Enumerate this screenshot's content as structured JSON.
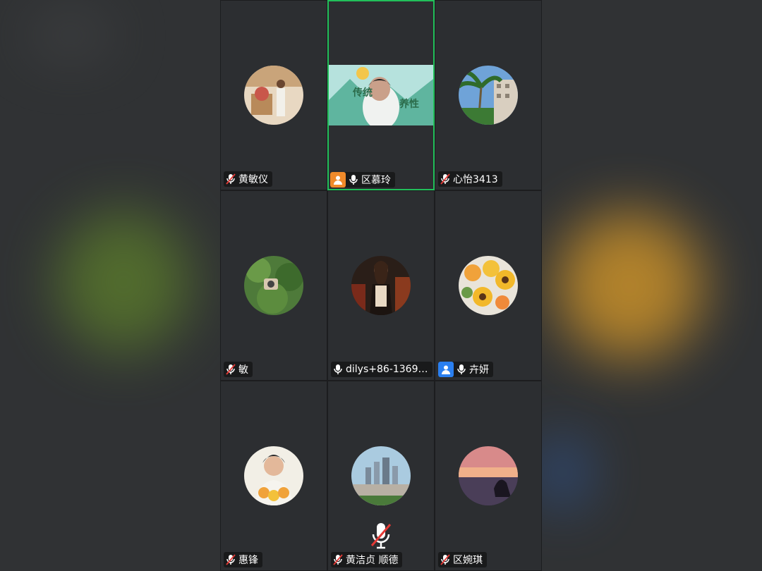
{
  "participants": [
    {
      "name": "黄敏仪",
      "mic": "muted",
      "role": null,
      "video": false,
      "active": false
    },
    {
      "name": "区慕玲",
      "mic": "on",
      "role": "host",
      "video": true,
      "active": true
    },
    {
      "name": "心怡3413",
      "mic": "muted",
      "role": null,
      "video": false,
      "active": false
    },
    {
      "name": "敏",
      "mic": "muted",
      "role": null,
      "video": false,
      "active": false
    },
    {
      "name": "dilys+86-13690…",
      "mic": "on",
      "role": null,
      "video": false,
      "active": false
    },
    {
      "name": "卉妍",
      "mic": "on",
      "role": "cohost",
      "video": false,
      "active": false
    },
    {
      "name": "惠锋",
      "mic": "muted",
      "role": null,
      "video": false,
      "active": false
    },
    {
      "name": "黄洁贞 顺德",
      "mic": "muted",
      "role": null,
      "video": false,
      "active": false
    },
    {
      "name": "区婉琪",
      "mic": "muted",
      "role": null,
      "video": false,
      "active": false
    }
  ],
  "video_banner": {
    "title": "传统",
    "subtitle": "养性"
  },
  "colors": {
    "active_border": "#22c05a",
    "host_badge": "#f08a2a",
    "cohost_badge": "#2a7ff0"
  },
  "icons": {
    "mic_on": "microphone-icon",
    "mic_muted": "microphone-muted-icon",
    "host": "user-badge-icon"
  }
}
